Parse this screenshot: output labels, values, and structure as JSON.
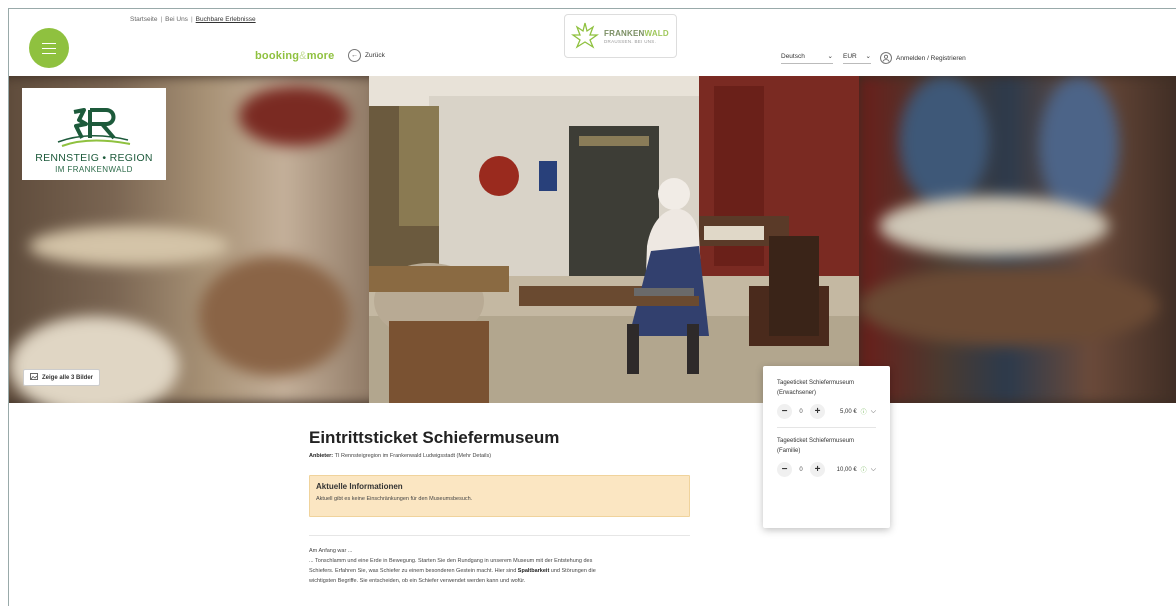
{
  "header": {
    "breadcrumb": [
      "Startseite",
      "Bei Uns",
      "Buchbare Erlebnisse"
    ],
    "booking_brand_a": "booking",
    "booking_brand_amp": "&",
    "booking_brand_b": "more",
    "back_label": "Zurück",
    "logo_name_a": "FRANKEN",
    "logo_name_b": "WALD",
    "logo_tagline": "DRAUSSEN. BEI UNS.",
    "language": "Deutsch",
    "currency": "EUR",
    "login_label": "Anmelden / Registrieren"
  },
  "hero": {
    "partner_logo_line1": "RENNSTEIG • REGION",
    "partner_logo_line2": "IM FRANKENWALD",
    "show_all_label": "Zeige alle 3 Bilder"
  },
  "product": {
    "title": "Eintrittsticket Schiefermuseum",
    "provider_label": "Anbieter:",
    "provider_value": "TI Rennsteigregion im Frankenwald Ludwigsstadt (Mehr Details)",
    "notice_heading": "Aktuelle Informationen",
    "notice_text": "Aktuell gibt es keine Einschränkungen für den Museumsbesuch.",
    "body_intro": "Am Anfang war ...",
    "body_line1": "... Tonschlamm und eine Erde in Bewegung. Starten Sie den Rundgang in unserem Museum mit der Entstehung des",
    "body_line2a": "Schiefers. Erfahren Sie, was Schiefer zu einem besonderen Gestein macht. Hier sind ",
    "body_line2b": "Spaltbarkeit",
    "body_line2c": " und Störungen die",
    "body_line3": "wichtigsten Begriffe. Sie entscheiden, ob ein Schiefer verwendet werden kann und wofür."
  },
  "tickets": [
    {
      "name": "Tageeticket Schiefermuseum (Erwachsener)",
      "qty": "0",
      "price": "5,00 €"
    },
    {
      "name": "Tageeticket Schiefermuseum (Familie)",
      "qty": "0",
      "price": "10,00 €"
    }
  ],
  "colors": {
    "brand_green": "#8fc13f",
    "notice_bg": "#fbe6c2"
  }
}
